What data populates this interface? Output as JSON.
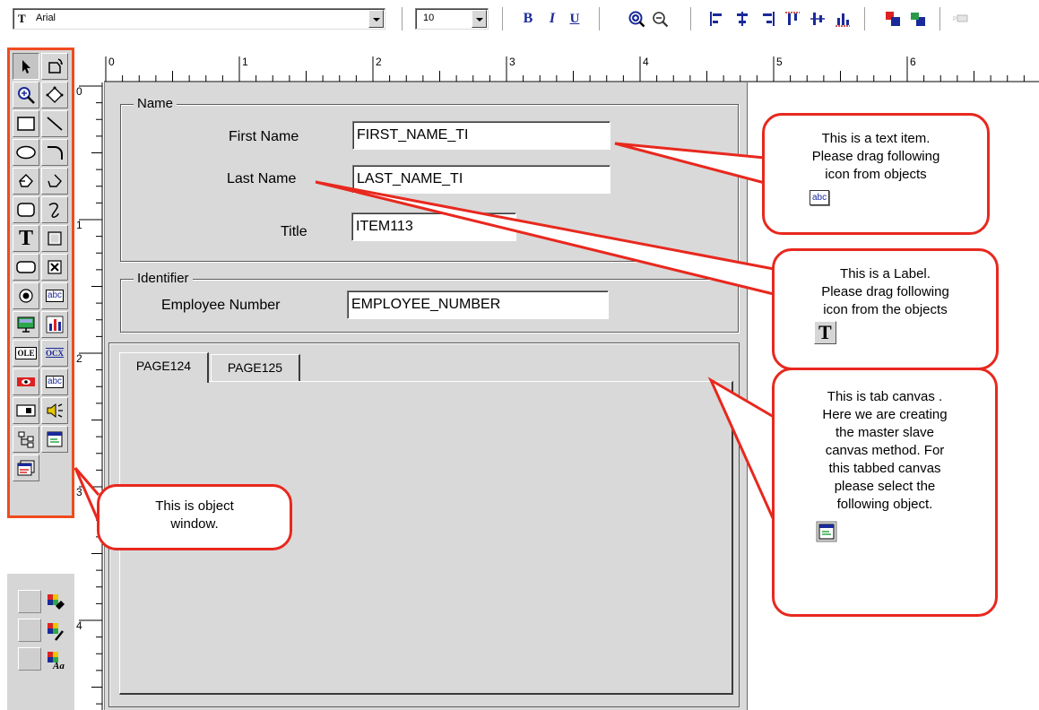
{
  "toolbar": {
    "font_name": "Arial",
    "font_size": "10",
    "bold_label": "B",
    "italic_label": "I",
    "underline_label": "U"
  },
  "ruler": {
    "h_numbers": [
      "0",
      "1",
      "2",
      "3",
      "4",
      "5",
      "6"
    ],
    "v_numbers": [
      "0",
      "1",
      "2",
      "3",
      "4"
    ]
  },
  "canvas": {
    "name_frame": {
      "title": "Name",
      "first_name_label": "First Name",
      "first_name_value": "FIRST_NAME_TI",
      "last_name_label": "Last Name",
      "last_name_value": "LAST_NAME_TI",
      "title_label": "Title",
      "title_value": "ITEM113"
    },
    "identifier_frame": {
      "title": "Identifier",
      "employee_number_label": "Employee Number",
      "employee_number_value": "EMPLOYEE_NUMBER"
    },
    "tabs": [
      {
        "label": "PAGE124"
      },
      {
        "label": "PAGE125"
      }
    ]
  },
  "palette": {
    "text_tool_glyph": "T",
    "abc_glyph": "abc",
    "ole_glyph": "OLE",
    "ocx_glyph": "OCX"
  },
  "callouts": {
    "text_item": {
      "line1": "This is a  text item.",
      "line2": "Please drag following",
      "line3": "icon from objects",
      "icon_label": "abc"
    },
    "label": {
      "line1": "This is a  Label.",
      "line2": "Please drag following",
      "line3": "icon from the objects",
      "icon_label": "T"
    },
    "tab_canvas": {
      "line1": "This is tab canvas .",
      "line2": "Here we are creating",
      "line3": "the master slave",
      "line4": "canvas method. For",
      "line5": "this tabbed canvas",
      "line6": "please select the",
      "line7": "following object."
    },
    "object_window": {
      "line1": "This is object",
      "line2": "window."
    }
  },
  "colors": {
    "callout_border": "#e8281e",
    "palette_border": "#ef4b1e",
    "canvas_bg": "#d9d9d9",
    "toolbar_icon_blue": "#1a2a9a"
  }
}
